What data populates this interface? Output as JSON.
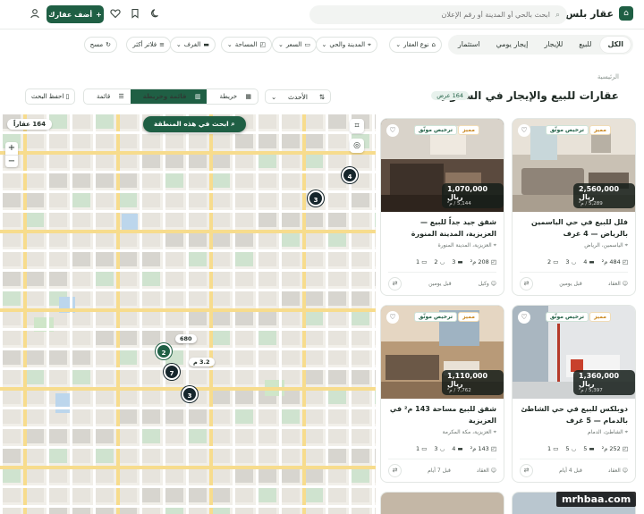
{
  "header": {
    "logo_text": "عقار بلس",
    "search_placeholder": "ابحث بالحي أو المدينة أو رقم الإعلان",
    "add_property_label": "أضف عقارك"
  },
  "tabs": [
    {
      "label": "الكل",
      "active": true
    },
    {
      "label": "للبيع",
      "active": false
    },
    {
      "label": "للإيجار",
      "active": false
    },
    {
      "label": "إيجار يومي",
      "active": false
    },
    {
      "label": "استثمار",
      "active": false
    }
  ],
  "filters": [
    {
      "label": "نوع العقار",
      "icon": "house-icon"
    },
    {
      "label": "المدينة والحي",
      "icon": "pin-icon"
    },
    {
      "label": "السعر",
      "icon": "cash-icon"
    },
    {
      "label": "المساحة",
      "icon": "area-icon"
    },
    {
      "label": "الغرف",
      "icon": "bed-icon"
    },
    {
      "label": "فلاتر أكثر",
      "icon": "sliders-icon"
    },
    {
      "label": "مسح",
      "icon": "reset-icon"
    }
  ],
  "breadcrumb": "الرئيسية",
  "page_title": "عقارات للبيع والإيجار في السعودية",
  "results_count": "164 عرض",
  "sort_label": "الأحدث",
  "view_modes": [
    {
      "label": "قائمة",
      "active": false
    },
    {
      "label": "قائمة وخريطة",
      "active": true
    },
    {
      "label": "خريطة",
      "active": false
    }
  ],
  "save_search_label": "احفظ البحث",
  "map": {
    "count_label": "164 عقاراً",
    "search_area_label": "ابحث في هذه المنطقة",
    "clusters": [
      {
        "count": "4",
        "style": "dark"
      },
      {
        "count": "3",
        "style": "dark"
      },
      {
        "count": "2",
        "style": "green"
      },
      {
        "count": "7",
        "style": "dark"
      },
      {
        "count": "3",
        "style": "dark"
      }
    ],
    "price_pins": [
      "680",
      "3.2 م"
    ]
  },
  "listings": [
    {
      "licensed": "ترخيص موثّق",
      "featured": "مميز",
      "price": "2,560,000 ريال",
      "price_per_m": "5,289 / م²",
      "title": "فلل للبيع في حي الياسمين بالرياض — 4 غرف",
      "location": "الياسمين، الرياض",
      "area": "484 م²",
      "beds": "4",
      "baths": "3",
      "living": "2",
      "agent": "العقاد",
      "date": "قبل يومين"
    },
    {
      "licensed": "ترخيص موثّق",
      "featured": "مميز",
      "price": "1,070,000 ريال",
      "price_per_m": "5,144 / م²",
      "title": "شقق جيد جداً للبيع — العزيزية، المدينة المنورة",
      "location": "العزيزية، المدينة المنورة",
      "area": "208 م²",
      "beds": "3",
      "baths": "2",
      "living": "1",
      "agent": "وكيل",
      "date": "قبل يومين"
    },
    {
      "licensed": "ترخيص موثّق",
      "featured": "مميز",
      "price": "1,360,000 ريال",
      "price_per_m": "5,397 / م²",
      "title": "دوبلكس للبيع في حي الشاطئ بالدمام — 5 غرف",
      "location": "الشاطئ، الدمام",
      "area": "252 م²",
      "beds": "5",
      "baths": "5",
      "living": "1",
      "agent": "العقاد",
      "date": "قبل 4 أيام"
    },
    {
      "licensed": "ترخيص موثّق",
      "featured": "مميز",
      "price": "1,110,000 ريال",
      "price_per_m": "7,762 / م²",
      "title": "شقق للبيع مساحة 143 م² في العزيزية",
      "location": "العزيزية، مكة المكرمة",
      "area": "143 م²",
      "beds": "4",
      "baths": "3",
      "living": "1",
      "agent": "العقاد",
      "date": "قبل 7 أيام"
    }
  ],
  "colors": {
    "brand": "#1f5f44",
    "map_bg": "#f1efe9",
    "featured": "#c9851c"
  },
  "watermark": "mrhbaa.com"
}
